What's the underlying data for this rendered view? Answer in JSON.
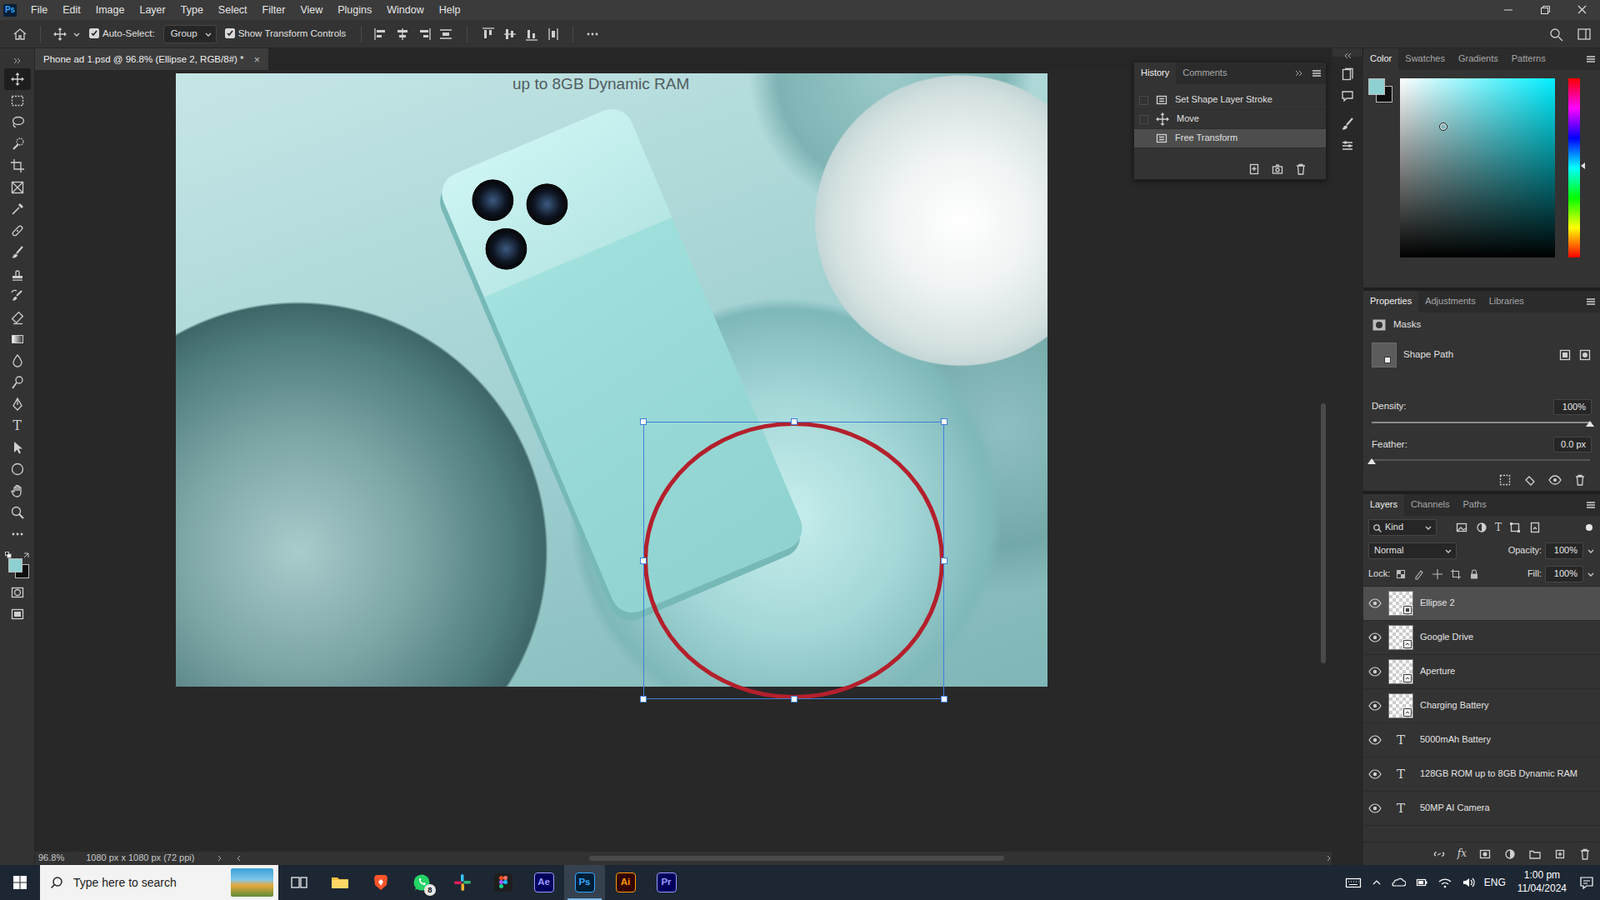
{
  "app": {
    "logo": "Ps"
  },
  "menu": [
    "File",
    "Edit",
    "Image",
    "Layer",
    "Type",
    "Select",
    "Filter",
    "View",
    "Plugins",
    "Window",
    "Help"
  ],
  "options_bar": {
    "auto_select": {
      "label": "Auto-Select:",
      "checked": true
    },
    "target": "Group",
    "transform_controls": {
      "label": "Show Transform Controls",
      "checked": true
    }
  },
  "document": {
    "tab_title": "Phone ad 1.psd @ 96.8% (Ellipse 2, RGB/8#) *",
    "close": "×",
    "caption": "up to 8GB Dynamic RAM"
  },
  "colors": {
    "foreground": "#8fd0d2",
    "background": "#0d0d0d"
  },
  "toolbar": {
    "tools": [
      {
        "kind": "move",
        "selected": true
      },
      {
        "kind": "marquee",
        "selected": false
      },
      {
        "kind": "lasso",
        "selected": false
      },
      {
        "kind": "quickselect",
        "selected": false
      },
      {
        "kind": "crop",
        "selected": false
      },
      {
        "kind": "frame",
        "selected": false
      },
      {
        "kind": "eyedropper",
        "selected": false
      },
      {
        "kind": "healing",
        "selected": false
      },
      {
        "kind": "brush",
        "selected": false
      },
      {
        "kind": "stamp",
        "selected": false
      },
      {
        "kind": "historybrush",
        "selected": false
      },
      {
        "kind": "eraser",
        "selected": false
      },
      {
        "kind": "gradient",
        "selected": false
      },
      {
        "kind": "blur",
        "selected": false
      },
      {
        "kind": "dodge",
        "selected": false
      },
      {
        "kind": "pen",
        "selected": false
      },
      {
        "kind": "type",
        "glyph": "T",
        "selected": false
      },
      {
        "kind": "pathselect",
        "selected": false
      },
      {
        "kind": "ellipse",
        "selected": false
      },
      {
        "kind": "hand",
        "selected": false
      },
      {
        "kind": "zoom",
        "selected": false
      },
      {
        "kind": "more",
        "selected": false
      }
    ]
  },
  "history": {
    "tabs": [
      {
        "label": "History",
        "selected": true
      },
      {
        "label": "Comments",
        "selected": false
      }
    ],
    "items": [
      {
        "label": "Set Shape Layer Stroke",
        "selected": false
      },
      {
        "label": "Move",
        "selected": false
      },
      {
        "label": "Free Transform",
        "selected": true
      }
    ]
  },
  "color_panel": {
    "tabs": [
      {
        "label": "Color",
        "selected": true
      },
      {
        "label": "Swatches",
        "selected": false
      },
      {
        "label": "Gradients",
        "selected": false
      },
      {
        "label": "Patterns",
        "selected": false
      }
    ],
    "hue_level": 0.51,
    "saturation": 0.28,
    "brightness": 0.73
  },
  "properties": {
    "tabs": [
      {
        "label": "Properties",
        "selected": true
      },
      {
        "label": "Adjustments",
        "selected": false
      },
      {
        "label": "Libraries",
        "selected": false
      }
    ],
    "section": "Masks",
    "mask_name": "Shape Path",
    "density": {
      "label": "Density:",
      "value": "100%",
      "level": 1
    },
    "feather": {
      "label": "Feather:",
      "value": "0.0 px",
      "level": 0
    }
  },
  "layers": {
    "tabs": [
      {
        "label": "Layers",
        "selected": true
      },
      {
        "label": "Channels",
        "selected": false
      },
      {
        "label": "Paths",
        "selected": false
      }
    ],
    "filter": "Kind",
    "type_filter": "T",
    "blend_mode": "Normal",
    "opacity": {
      "label": "Opacity:",
      "value": "100%"
    },
    "lock_label": "Lock:",
    "fill": {
      "label": "Fill:",
      "value": "100%"
    },
    "items": [
      {
        "name": "Ellipse 2",
        "kind": "shape",
        "visible": true,
        "selected": true
      },
      {
        "name": "Google Drive",
        "kind": "smart",
        "visible": true,
        "selected": false
      },
      {
        "name": "Aperture",
        "kind": "smart",
        "visible": true,
        "selected": false
      },
      {
        "name": "Charging Battery",
        "kind": "smart",
        "visible": true,
        "selected": false
      },
      {
        "name": "5000mAh Battery",
        "kind": "text",
        "icon": "T",
        "visible": true,
        "selected": false
      },
      {
        "name": "128GB ROM up to 8GB Dynamic RAM",
        "kind": "text",
        "icon": "T",
        "visible": true,
        "selected": false
      },
      {
        "name": "50MP AI Camera",
        "kind": "text",
        "icon": "T",
        "visible": true,
        "selected": false
      }
    ],
    "fx": "fx"
  },
  "status_bar": {
    "zoom": "96.8%",
    "doc_info": "1080 px x 1080 px (72 ppi)"
  },
  "taskbar": {
    "search_placeholder": "Type here to search",
    "apps": [
      {
        "kind": "taskview",
        "active": false
      },
      {
        "kind": "explorer",
        "active": false
      },
      {
        "kind": "brave",
        "active": false
      },
      {
        "kind": "whatsapp",
        "badge": "8",
        "active": false
      },
      {
        "kind": "slack",
        "active": false
      },
      {
        "kind": "figma",
        "active": false
      },
      {
        "kind": "adobe",
        "label": "Ae",
        "color": "#9999ff",
        "active": false
      },
      {
        "kind": "adobe",
        "label": "Ps",
        "color": "#31a8ff",
        "active": true
      },
      {
        "kind": "adobe",
        "label": "Ai",
        "color": "#ff9a00",
        "active": false
      },
      {
        "kind": "adobe",
        "label": "Pr",
        "color": "#9999ff",
        "active": false
      }
    ],
    "language": "ENG",
    "time": "1:00 pm",
    "date": "11/04/2024"
  }
}
